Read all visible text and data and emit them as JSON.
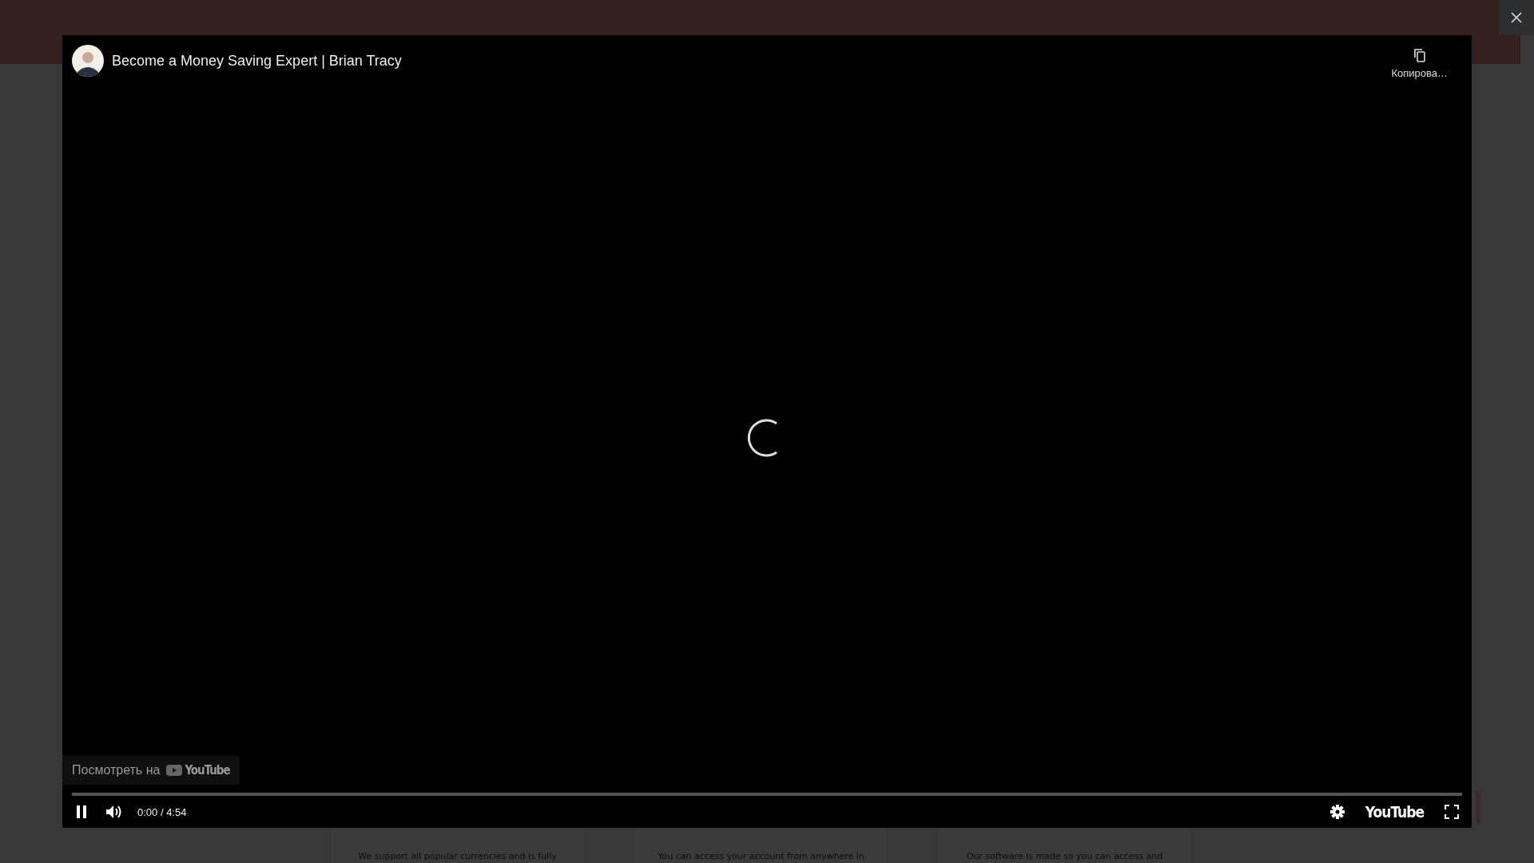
{
  "page": {
    "cards": [
      {
        "text": "We support all popular currencies and is fully"
      },
      {
        "text": "You can access your account from anywhere in"
      },
      {
        "text": "Our software is made so you can access and"
      }
    ]
  },
  "video": {
    "title": "Become a Money Saving Expert | Brian Tracy",
    "copy_label": "Копирова…",
    "watch_on": "Посмотреть на",
    "watch_logo": "YouTube",
    "playing": true,
    "level": 0,
    "time": "0:00 / 4:54",
    "logo": "YouTube"
  }
}
